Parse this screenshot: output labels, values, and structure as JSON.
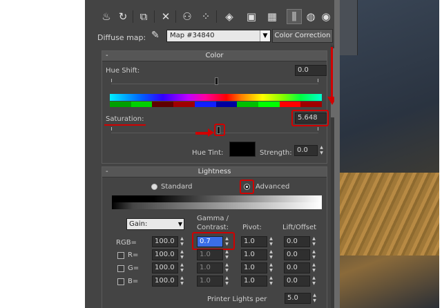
{
  "toolbar": {
    "icons": [
      "teapot-icon",
      "teapot-swap-icon",
      "copy-icon",
      "delete-icon",
      "material-id-icon",
      "sphere-grid-icon",
      "checker-icon",
      "preview-icon",
      "background-icon",
      "show-map-icon",
      "backlight-icon",
      "options-icon"
    ]
  },
  "map_row": {
    "label": "Diffuse map:",
    "map_name": "Map #34840",
    "button": "Color Correction"
  },
  "color": {
    "title": "Color",
    "collapse": "-",
    "hue_shift_label": "Hue Shift:",
    "hue_shift_value": "0.0",
    "saturation_label": "Saturation:",
    "saturation_value": "5.648",
    "hue_tint_label": "Hue Tint:",
    "hue_tint_color": "#000000",
    "strength_label": "Strength:",
    "strength_value": "0.0"
  },
  "lightness": {
    "title": "Lightness",
    "collapse": "-",
    "mode_standard": "Standard",
    "mode_advanced": "Advanced",
    "selected_mode": "Advanced",
    "gain_select": "Gain:",
    "col_gamma": "Gamma /",
    "col_contrast": "Contrast:",
    "col_pivot": "Pivot:",
    "col_lift": "Lift/Offset",
    "rows": [
      {
        "label": "RGB=",
        "gain": "100.0",
        "gamma": "0.7",
        "pivot": "1.0",
        "lift": "0.0"
      },
      {
        "label": "R=",
        "gain": "100.0",
        "gamma": "1.0",
        "pivot": "1.0",
        "lift": "0.0"
      },
      {
        "label": "G=",
        "gain": "100.0",
        "gamma": "1.0",
        "pivot": "1.0",
        "lift": "0.0"
      },
      {
        "label": "B=",
        "gain": "100.0",
        "gamma": "1.0",
        "pivot": "1.0",
        "lift": "0.0"
      }
    ],
    "printer_label": "Printer Lights per",
    "printer_value": "5.0"
  },
  "colors": {
    "panel": "#444444",
    "annotation": "#d10000"
  }
}
